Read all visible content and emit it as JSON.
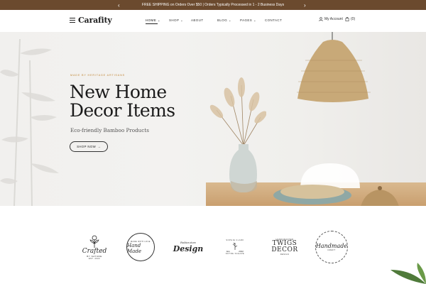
{
  "announcement": {
    "text": "FREE SHIPPING on Orders Over $50 | Orders Typically Processed in 1 - 2 Business Days",
    "prev_icon": "chevron-left-icon",
    "next_icon": "chevron-right-icon"
  },
  "header": {
    "logo": "Carafity",
    "nav": [
      {
        "label": "HOME",
        "has_dropdown": true,
        "active": true
      },
      {
        "label": "SHOP",
        "has_dropdown": true
      },
      {
        "label": "ABOUT",
        "has_dropdown": false
      },
      {
        "label": "BLOG",
        "has_dropdown": true
      },
      {
        "label": "PAGES",
        "has_dropdown": true
      },
      {
        "label": "CONTACT",
        "has_dropdown": false
      }
    ],
    "account_label": "My Account",
    "cart_count": "(0)"
  },
  "hero": {
    "kicker": "MADE BY HERITAGE ARTISANS",
    "title_line1": "New Home",
    "title_line2": "Decor Items",
    "subtitle": "Eco-friendly Bamboo Products",
    "button_label": "SHOP NOW",
    "button_arrow": "→"
  },
  "brands": {
    "b1": {
      "line1": "Crafted",
      "line2": "BY NATURE",
      "line3": "EST. 2022"
    },
    "b2": {
      "line1": "Hand Made",
      "ring": "MADE WITH LOVE"
    },
    "b3": {
      "line1": "Design",
      "top": "Fashion store"
    },
    "b4": {
      "ring_top": "SOPHIE CLARK",
      "left": "Est.",
      "right": "2022",
      "ring_bottom": "NOTRE SCHAPE"
    },
    "b5": {
      "top": "HANDCRAFTED",
      "line1": "TWIGS",
      "line2": "DECOR",
      "bottom": "DESIGN"
    },
    "b6": {
      "line1": "Handmade",
      "line2": "CRAFT"
    }
  },
  "colors": {
    "announcement_bg": "#6b4a2e",
    "kicker": "#c28a3c",
    "text_dark": "#1a1a1a"
  }
}
